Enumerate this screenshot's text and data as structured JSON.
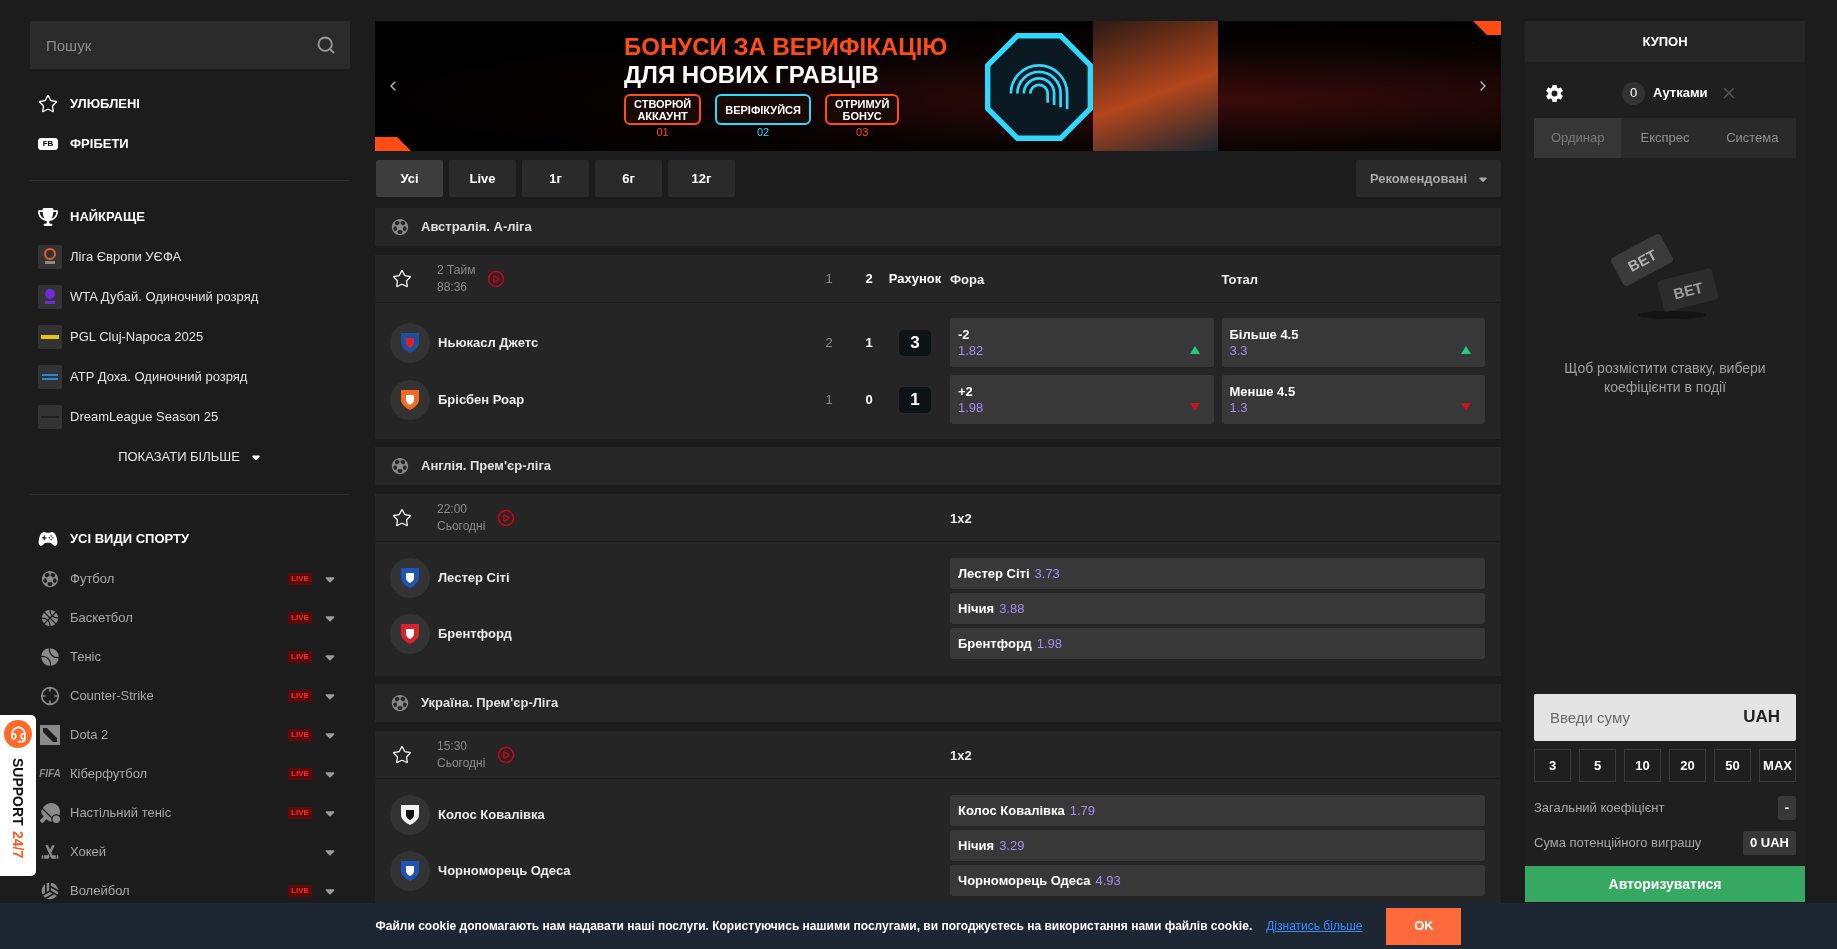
{
  "sidebar": {
    "search": {
      "placeholder": "Пошук"
    },
    "links": [
      {
        "kind": "favorites",
        "label": "УЛЮБЛЕНІ"
      },
      {
        "kind": "freebets",
        "label": "ФРІБЕТИ",
        "badge": "FB"
      }
    ],
    "top": {
      "title": "НАЙКРАЩЕ",
      "items": [
        {
          "label": "Ліга Європи УЄФА"
        },
        {
          "label": "WTA Дубай. Одиночний розряд"
        },
        {
          "label": "PGL Cluj-Napoca 2025"
        },
        {
          "label": "ATP Доха. Одиночний розряд"
        },
        {
          "label": "DreamLeague Season 25"
        }
      ],
      "show_more": "ПОКАЗАТИ БІЛЬШЕ"
    },
    "sports": {
      "title": "УСІ ВИДИ СПОРТУ",
      "items": [
        {
          "label": "Футбол",
          "live": "LIVE"
        },
        {
          "label": "Баскетбол",
          "live": "LIVE"
        },
        {
          "label": "Теніс",
          "live": "LIVE"
        },
        {
          "label": "Counter-Strike",
          "live": "LIVE"
        },
        {
          "label": "Dota 2",
          "live": "LIVE"
        },
        {
          "label": "Кіберфутбол",
          "live": "LIVE",
          "icon_text": "FIFA"
        },
        {
          "label": "Настільний теніс",
          "live": "LIVE"
        },
        {
          "label": "Хокей"
        },
        {
          "label": "Волейбол",
          "live": "LIVE"
        }
      ]
    }
  },
  "support": {
    "label": "SUPPORT",
    "hours": "24/7"
  },
  "banner": {
    "headline": "БОНУСИ ЗА ВЕРИФІКАЦІЮ",
    "subheadline": "ДЛЯ НОВИХ ГРАВЦІВ",
    "steps": [
      {
        "label": "СТВОРЮЙ АККАУНТ",
        "number": "01",
        "color": "#ff4d14"
      },
      {
        "label": "ВЕРІФІКУЙСЯ",
        "number": "02",
        "color": "#2fd8ff"
      },
      {
        "label": "ОТРИМУЙ БОНУС",
        "number": "03",
        "color": "#ff4d14"
      }
    ]
  },
  "filters": {
    "tabs": [
      {
        "label": "Усі",
        "selected": true
      },
      {
        "label": "Live",
        "selected": false
      },
      {
        "label": "1г",
        "selected": false
      },
      {
        "label": "6г",
        "selected": false
      },
      {
        "label": "12г",
        "selected": false
      }
    ],
    "sort": "Рекомендовані"
  },
  "leagues": [
    {
      "name": "Австралія. А-ліга",
      "matches": [
        {
          "kind": "live",
          "period": "2 Тайм",
          "clock": "88:36",
          "headers": {
            "period_1": "1",
            "period_2": "2",
            "score": "Рахунок"
          },
          "markets": [
            "Фора",
            "Тотал"
          ],
          "teams": [
            {
              "name": "Ньюкасл Джетс",
              "period_1": "2",
              "period_2": "1",
              "score": "3",
              "odds": [
                {
                  "line": "-2",
                  "value": "1.82",
                  "rising": true
                },
                {
                  "line": "Більше 4.5",
                  "value": "3.3",
                  "rising": true
                }
              ]
            },
            {
              "name": "Брісбен Роар",
              "period_1": "1",
              "period_2": "0",
              "score": "1",
              "odds": [
                {
                  "line": "+2",
                  "value": "1.98",
                  "rising": false
                },
                {
                  "line": "Менше 4.5",
                  "value": "1.3",
                  "rising": false
                }
              ]
            }
          ]
        }
      ]
    },
    {
      "name": "Англія. Прем'єр-ліга",
      "matches": [
        {
          "kind": "prematch",
          "start_time": "22:00",
          "day": "Сьогодні",
          "market": "1x2",
          "teams": [
            {
              "name": "Лестер Сіті"
            },
            {
              "name": "Брентфорд"
            }
          ],
          "outcomes": [
            {
              "label": "Лестер Сіті",
              "value": "3.73"
            },
            {
              "label": "Нічия",
              "value": "3.88"
            },
            {
              "label": "Брентфорд",
              "value": "1.98"
            }
          ]
        }
      ]
    },
    {
      "name": "Україна. Прем'єр-Ліга",
      "matches": [
        {
          "kind": "prematch",
          "start_time": "15:30",
          "day": "Сьогодні",
          "market": "1x2",
          "teams": [
            {
              "name": "Колос Ковалівка"
            },
            {
              "name": "Чорноморець Одеса"
            }
          ],
          "outcomes": [
            {
              "label": "Колос Ковалівка",
              "value": "1.79"
            },
            {
              "label": "Нічия",
              "value": "3.29"
            },
            {
              "label": "Чорноморець Одеса",
              "value": "4.93"
            }
          ]
        }
      ]
    }
  ],
  "coupon": {
    "title": "КУПОН",
    "count": "0",
    "mode": "Аутками",
    "tabs": [
      {
        "label": "Ординар",
        "selected": true
      },
      {
        "label": "Експрес",
        "selected": false
      },
      {
        "label": "Система",
        "selected": false
      }
    ],
    "tickets": [
      "BET",
      "BET"
    ],
    "empty_text": "Щоб розмістити ставку, вибери коефіцієнти в події",
    "amount": {
      "placeholder": "Введи суму",
      "currency": "UAH"
    },
    "quick_stakes": [
      "3",
      "5",
      "10",
      "20",
      "50",
      "MAX"
    ],
    "summary": [
      {
        "label": "Загальний коефіцієнт",
        "value": "-"
      },
      {
        "label": "Сума потенційного виграшу",
        "value": "0 UAH"
      }
    ],
    "login": "Авторизуватися"
  },
  "cookie": {
    "text": "Файли cookie допомагають нам надавати наші послуги. Користуючись нашими послугами, ви погоджуєтесь на використання нами файлів cookie.",
    "link": "Дізнатись більше",
    "button": "OK"
  }
}
